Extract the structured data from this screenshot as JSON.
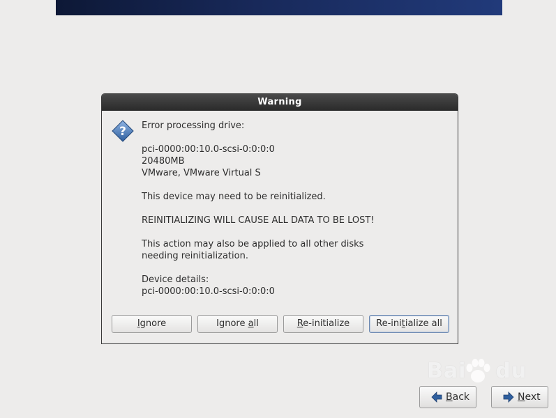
{
  "dialog": {
    "title": "Warning",
    "icon": "question-icon",
    "message_lines": [
      "Error processing drive:",
      "",
      "pci-0000:00:10.0-scsi-0:0:0:0",
      "20480MB",
      "VMware, VMware Virtual S",
      "",
      "This device may need to be reinitialized.",
      "",
      "REINITIALIZING WILL CAUSE ALL DATA TO BE LOST!",
      "",
      "This action may also be applied to all other disks",
      "needing reinitialization.",
      "",
      "Device details:",
      "pci-0000:00:10.0-scsi-0:0:0:0"
    ],
    "buttons": {
      "ignore": {
        "pre": "",
        "mn": "I",
        "post": "gnore"
      },
      "ignore_all": {
        "pre": "Ignore ",
        "mn": "a",
        "post": "ll"
      },
      "reinit": {
        "pre": "",
        "mn": "R",
        "post": "e-initialize"
      },
      "reinit_all": {
        "pre": "Re-ini",
        "mn": "t",
        "post": "ialize all"
      }
    }
  },
  "nav": {
    "back": {
      "pre": "",
      "mn": "B",
      "post": "ack"
    },
    "next": {
      "pre": "",
      "mn": "N",
      "post": "ext"
    }
  },
  "watermark": {
    "text_left": "Bai",
    "text_right": "du"
  },
  "colors": {
    "banner": "#18295a",
    "icon_blue": "#3b6fb0",
    "arrow_blue": "#2f5f9e"
  }
}
